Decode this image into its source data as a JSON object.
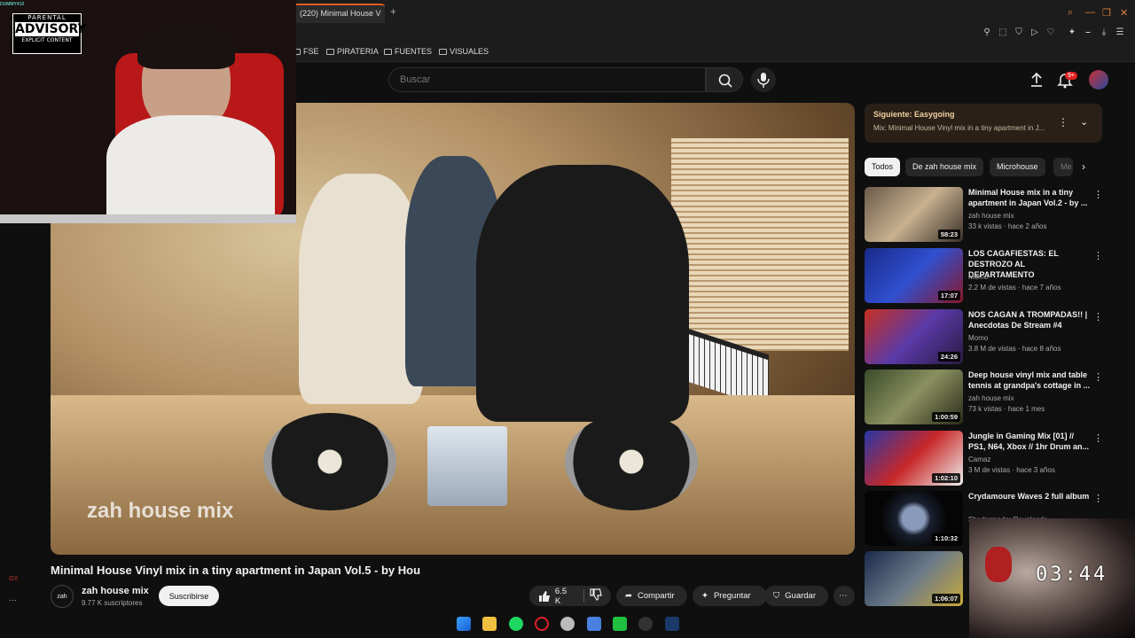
{
  "browser": {
    "tab_title": "(220) Minimal House V",
    "new_tab": "+",
    "bookmarks": [
      "FSE",
      "PIRATERIA",
      "FUENTES",
      "VISUALES"
    ]
  },
  "header": {
    "search_placeholder": "Buscar",
    "notifications_badge": "9+"
  },
  "facecam": {
    "tag": "DUMMY410",
    "logo_top": "PARENTAL",
    "logo_mid": "ADVISORY",
    "logo_bottom": "EXPLICIT CONTENT"
  },
  "video": {
    "watermark": "zah house mix",
    "title": "Minimal House Vinyl mix in a tiny apartment in Japan Vol.5 - by Hou"
  },
  "channel": {
    "avatar_text": "zah",
    "name": "zah house mix",
    "subs": "9.77 K suscriptores",
    "subscribe": "Suscribirse"
  },
  "actions": {
    "likes": "6.5 K",
    "share": "Compartir",
    "ask": "Preguntar",
    "save": "Guardar"
  },
  "up_next": {
    "label": "Siguiente: Easygoing",
    "playlist": "Mix: Minimal House Vinyl mix in a tiny apartment in J..."
  },
  "chips": [
    "Todos",
    "De zah house mix",
    "Microhouse",
    "Me"
  ],
  "recommendations": [
    {
      "title": "Minimal House mix in a tiny apartment in Japan Vol.2 - by ...",
      "channel": "zah house mix",
      "meta": "33 k vistas · hace 2 años",
      "duration": "58:23"
    },
    {
      "title": "LOS CAGAFIESTAS: EL DESTROZO AL DEPARTAMENTO",
      "channel": "Momo",
      "meta": "2.2 M de vistas · hace 7 años",
      "duration": "17:07"
    },
    {
      "title": "NOS CAGAN A TROMPADAS!! | Anecdotas De Stream #4",
      "channel": "Momo",
      "meta": "3.8 M de vistas · hace 8 años",
      "duration": "24:26"
    },
    {
      "title": "Deep house vinyl mix and table tennis at grandpa's cottage in ...",
      "channel": "zah house mix",
      "meta": "73 k vistas · hace 1 mes",
      "duration": "1:00:59"
    },
    {
      "title": "Jungle in Gaming Mix [01] // PS1, N64, Xbox // 1hr Drum an...",
      "channel": "Camaz",
      "meta": "3 M de vistas · hace 3 años",
      "duration": "1:02:10"
    },
    {
      "title": "Crydamoure Waves 2 full album",
      "channel": "Shadermader Reuploads",
      "meta": "",
      "duration": "1:10:32"
    },
    {
      "title": "",
      "channel": "",
      "meta": "",
      "duration": "1:06:07"
    }
  ],
  "timer": "03:44",
  "gx_label": "GX"
}
